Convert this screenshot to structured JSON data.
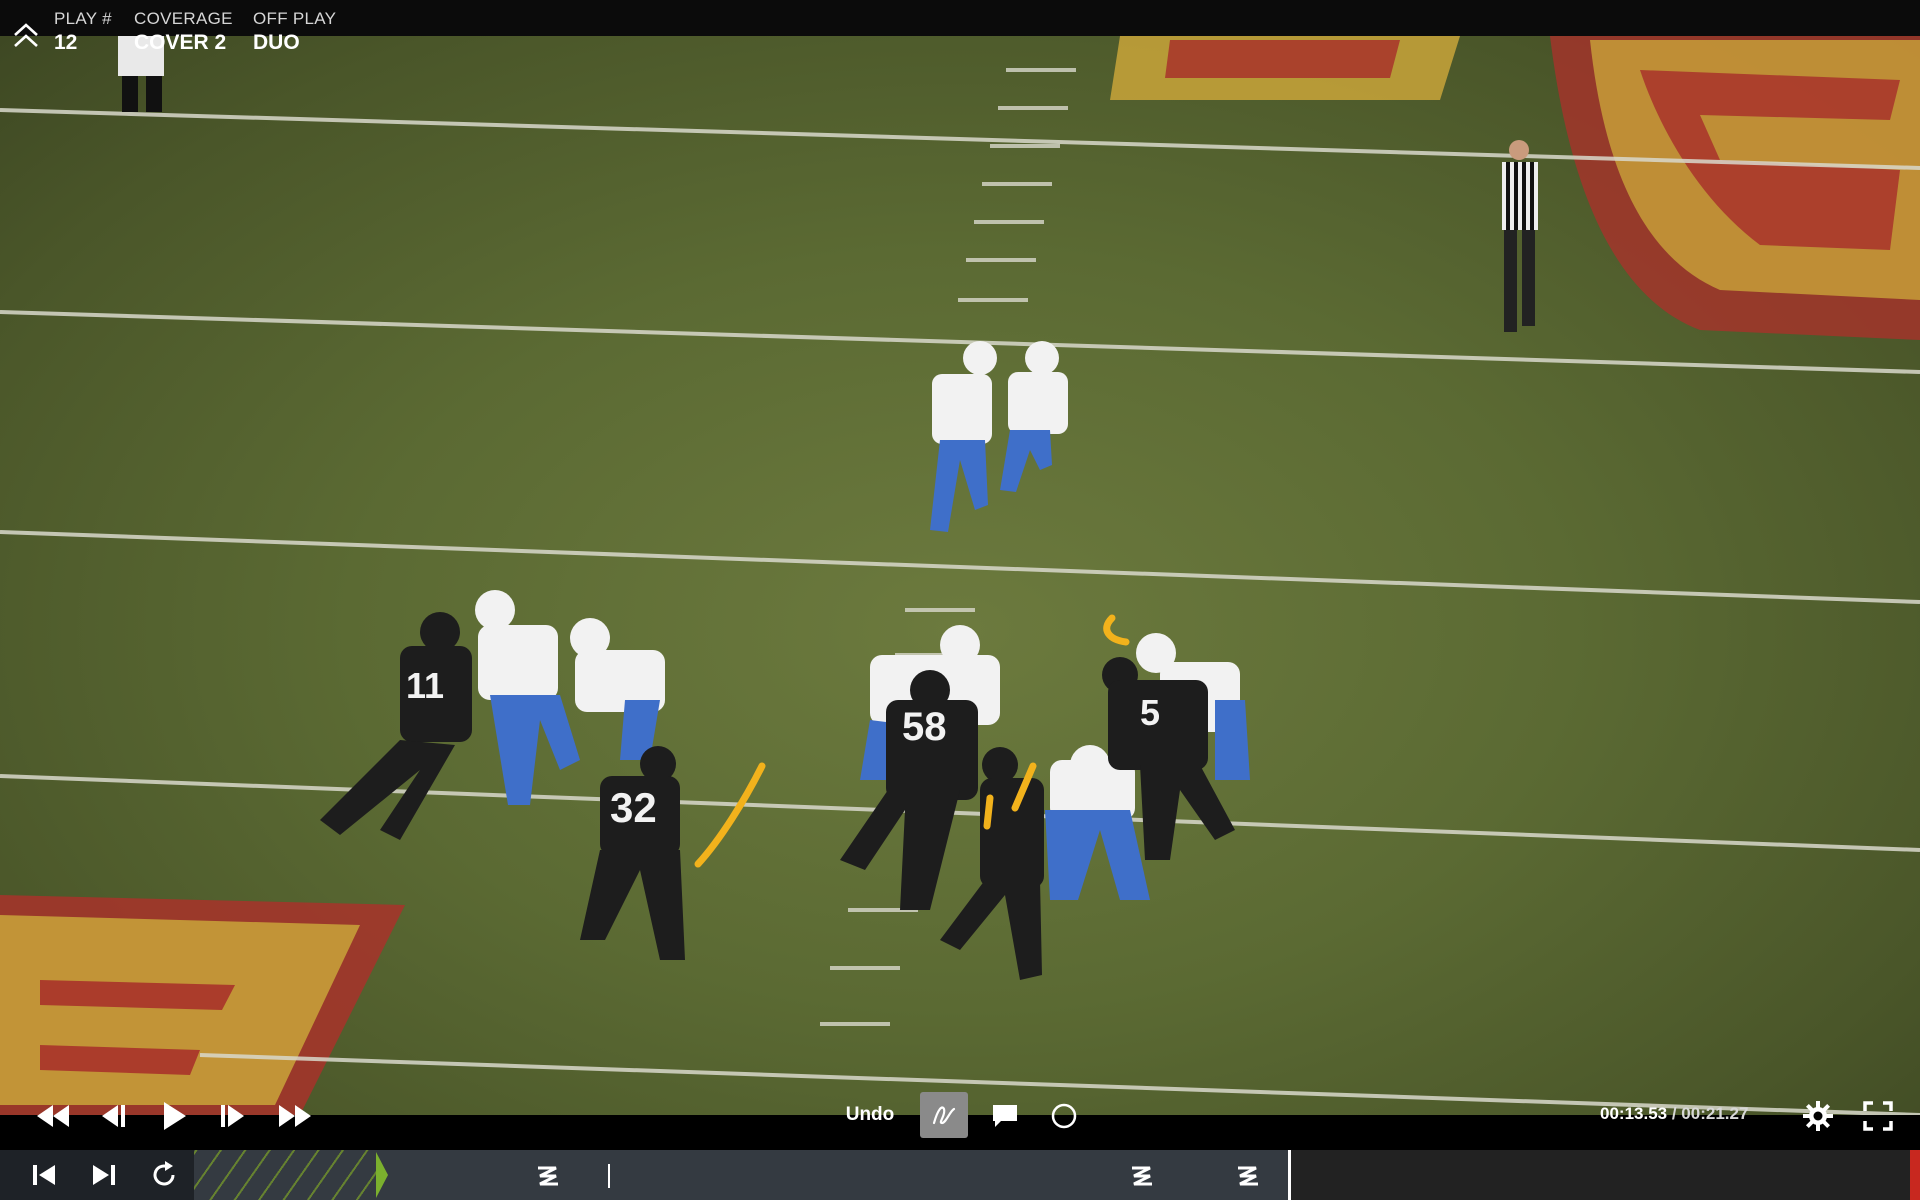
{
  "header": {
    "play": {
      "label": "PLAY #",
      "value": "12"
    },
    "coverage": {
      "label": "COVERAGE",
      "value": "COVER 2"
    },
    "off_play": {
      "label": "OFF PLAY",
      "value": "DUO"
    }
  },
  "video": {
    "jersey_numbers": [
      "11",
      "32",
      "58",
      "5"
    ]
  },
  "controls": {
    "undo_label": "Undo",
    "time_current": "00:13.53",
    "time_separator": " / ",
    "time_total": "00:21.27"
  },
  "colors": {
    "field_green": "#5b6a33",
    "endzone_red": "#a8322a",
    "endzone_gold": "#c9a43a",
    "annotation_yellow": "#f2b21c",
    "offense_white": "#f2f2f2",
    "offense_blue": "#3f6fc9",
    "defense_black": "#1d1d1d",
    "timeline_bg": "#2a2f35",
    "progress_green": "#7bb02e"
  },
  "icons": [
    "chevron-up-icon",
    "rewind-icon",
    "step-back-icon",
    "play-icon",
    "step-forward-icon",
    "fast-forward-icon",
    "pen-icon",
    "comment-icon",
    "circle-icon",
    "gear-icon",
    "fullscreen-icon",
    "skip-start-icon",
    "skip-end-icon",
    "replay-icon",
    "zigzag-marker-icon"
  ]
}
